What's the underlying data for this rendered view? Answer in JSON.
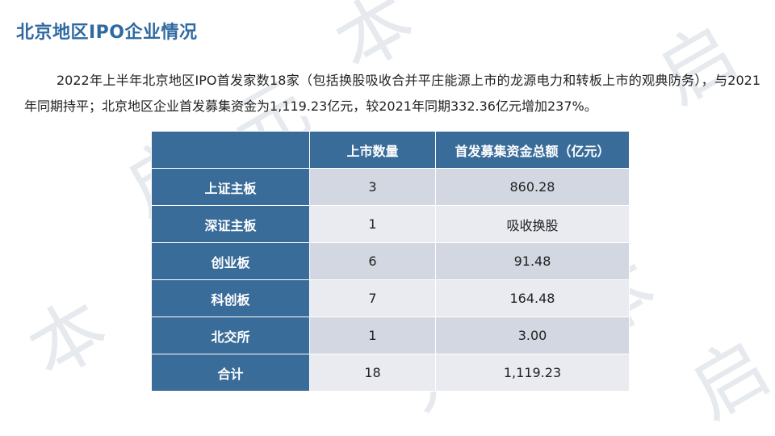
{
  "title": "北京地区IPO企业情况",
  "paragraph": "2022年上半年北京地区IPO首发家数18家（包括换股吸收合并平庄能源上市的龙源电力和转板上市的观典防务），与2021年同期持平；北京地区企业首发募集资金为1,119.23亿元，较2021年同期332.36亿元增加237%。",
  "table": {
    "headers": [
      "",
      "上市数量",
      "首发募集资金总额（亿元）"
    ],
    "rows": [
      {
        "board": "上证主板",
        "count": "3",
        "amount": "860.28"
      },
      {
        "board": "深证主板",
        "count": "1",
        "amount": "吸收换股"
      },
      {
        "board": "创业板",
        "count": "6",
        "amount": "91.48"
      },
      {
        "board": "科创板",
        "count": "7",
        "amount": "164.48"
      },
      {
        "board": "北交所",
        "count": "1",
        "amount": "3.00"
      },
      {
        "board": "合计",
        "count": "18",
        "amount": "1,119.23"
      }
    ]
  },
  "colors": {
    "title": "#2e6aa1",
    "header_bg": "#3a6c9a",
    "row_odd": "#d2d7e1",
    "row_even": "#e9ebf0"
  }
}
